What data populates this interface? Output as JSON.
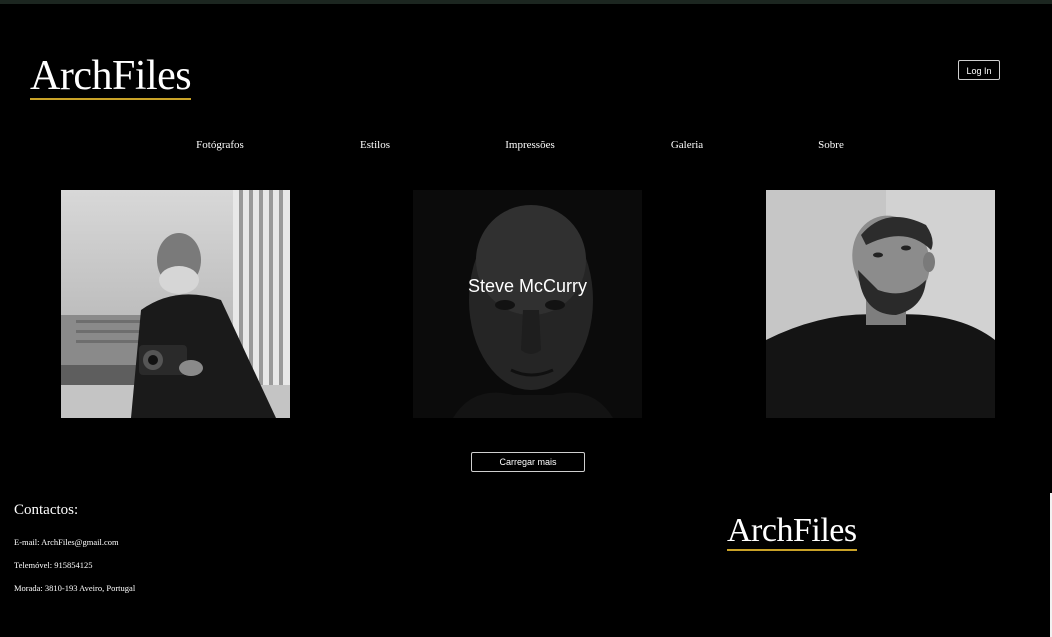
{
  "header": {
    "logo": "ArchFiles",
    "login_label": "Log In"
  },
  "nav": {
    "items": [
      {
        "label": "Fotógrafos"
      },
      {
        "label": "Estilos"
      },
      {
        "label": "Impressões"
      },
      {
        "label": "Galeria"
      },
      {
        "label": "Sobre"
      }
    ]
  },
  "gallery": {
    "cards": [
      {
        "caption": ""
      },
      {
        "caption": "Steve McCurry"
      },
      {
        "caption": ""
      }
    ],
    "load_more_label": "Carregar mais"
  },
  "footer": {
    "contacts_title": "Contactos:",
    "email": "E-mail: ArchFiles@gmail.com",
    "phone": "Telemóvel: 915854125",
    "address": "Morada: 3810-193 Aveiro, Portugal",
    "logo": "ArchFiles"
  },
  "colors": {
    "background": "#000000",
    "accent_underline": "#c9a227",
    "text": "#ffffff"
  }
}
